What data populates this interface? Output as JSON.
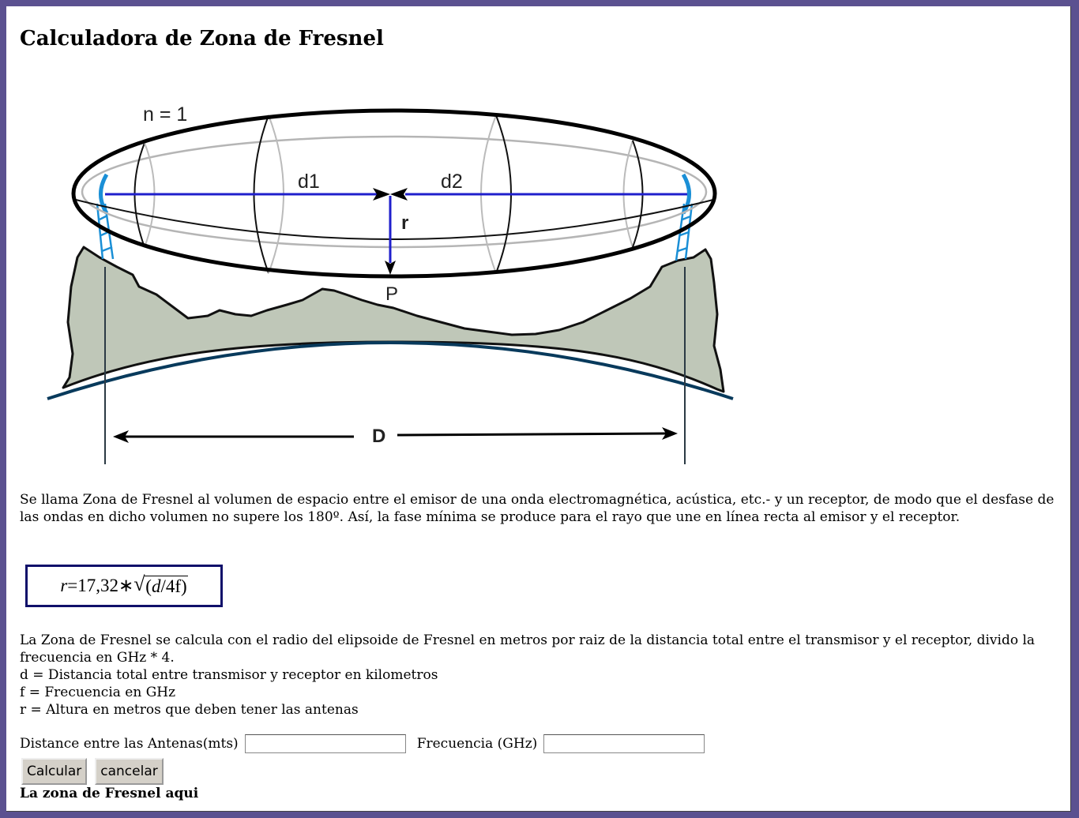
{
  "title": "Calculadora de Zona de Fresnel",
  "diagram": {
    "label_n": "n = 1",
    "label_d1": "d1",
    "label_d2": "d2",
    "label_r": "r",
    "label_p": "P",
    "label_D": "D"
  },
  "intro_text": "Se llama Zona de Fresnel al volumen de espacio entre el emisor de una onda electromagnética, acústica, etc.- y un receptor, de modo que el desfase de las ondas en dicho volumen no supere los 180º. Así, la fase mínima se produce para el rayo que une en línea recta al emisor y el receptor.",
  "formula": {
    "lhs": "r",
    "eq": "=17,32∗",
    "radicand_d": "d",
    "radicand_rest": "/4f"
  },
  "explanation": {
    "line1": "La Zona de Fresnel se calcula con el radio del elipsoide de Fresnel en metros por raiz de la distancia total entre el transmisor y el receptor, divido la frecuencia en GHz * 4.",
    "line_d": "d = Distancia total entre transmisor y receptor en kilometros",
    "line_f": "f = Frecuencia en GHz",
    "line_r": "r = Altura en metros que deben tener las antenas"
  },
  "form": {
    "distance_label": "Distance entre las Antenas(mts)",
    "distance_value": "",
    "frequency_label": "Frecuencia (GHz)",
    "frequency_value": "",
    "calculate_label": "Calcular",
    "cancel_label": "cancelar"
  },
  "result_text": "La zona de Fresnel aqui",
  "colors": {
    "page_border": "#5b5190",
    "terrain_fill": "#bfc7b8",
    "earth_curve": "#083a5c",
    "ray_line": "#1f1fcc",
    "antenna": "#1a8fd6",
    "formula_border": "#10106a"
  }
}
